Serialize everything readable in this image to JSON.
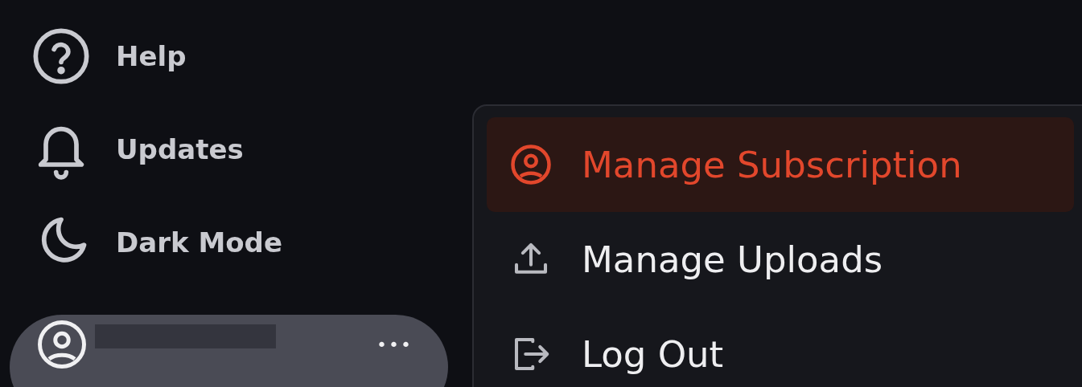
{
  "sidebar": {
    "items": [
      {
        "label": "Help",
        "kind": "help"
      },
      {
        "label": "Updates",
        "kind": "bell"
      },
      {
        "label": "Dark Mode",
        "kind": "moon"
      }
    ],
    "account": {
      "menu_button": "•••"
    }
  },
  "account_menu": {
    "items": [
      {
        "label": "Manage Subscription",
        "kind": "user",
        "selected": true
      },
      {
        "label": "Manage Uploads",
        "kind": "upload",
        "selected": false
      },
      {
        "label": "Log Out",
        "kind": "logout",
        "selected": false
      }
    ]
  }
}
